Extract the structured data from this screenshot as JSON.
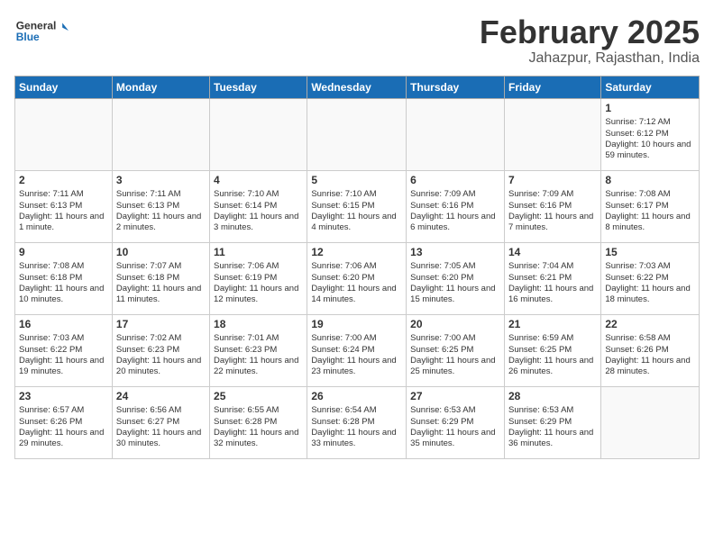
{
  "header": {
    "logo_text_general": "General",
    "logo_text_blue": "Blue",
    "month_title": "February 2025",
    "location": "Jahazpur, Rajasthan, India"
  },
  "calendar": {
    "days_of_week": [
      "Sunday",
      "Monday",
      "Tuesday",
      "Wednesday",
      "Thursday",
      "Friday",
      "Saturday"
    ],
    "weeks": [
      [
        {
          "day": "",
          "info": ""
        },
        {
          "day": "",
          "info": ""
        },
        {
          "day": "",
          "info": ""
        },
        {
          "day": "",
          "info": ""
        },
        {
          "day": "",
          "info": ""
        },
        {
          "day": "",
          "info": ""
        },
        {
          "day": "1",
          "info": "Sunrise: 7:12 AM\nSunset: 6:12 PM\nDaylight: 10 hours and 59 minutes."
        }
      ],
      [
        {
          "day": "2",
          "info": "Sunrise: 7:11 AM\nSunset: 6:13 PM\nDaylight: 11 hours and 1 minute."
        },
        {
          "day": "3",
          "info": "Sunrise: 7:11 AM\nSunset: 6:13 PM\nDaylight: 11 hours and 2 minutes."
        },
        {
          "day": "4",
          "info": "Sunrise: 7:10 AM\nSunset: 6:14 PM\nDaylight: 11 hours and 3 minutes."
        },
        {
          "day": "5",
          "info": "Sunrise: 7:10 AM\nSunset: 6:15 PM\nDaylight: 11 hours and 4 minutes."
        },
        {
          "day": "6",
          "info": "Sunrise: 7:09 AM\nSunset: 6:16 PM\nDaylight: 11 hours and 6 minutes."
        },
        {
          "day": "7",
          "info": "Sunrise: 7:09 AM\nSunset: 6:16 PM\nDaylight: 11 hours and 7 minutes."
        },
        {
          "day": "8",
          "info": "Sunrise: 7:08 AM\nSunset: 6:17 PM\nDaylight: 11 hours and 8 minutes."
        }
      ],
      [
        {
          "day": "9",
          "info": "Sunrise: 7:08 AM\nSunset: 6:18 PM\nDaylight: 11 hours and 10 minutes."
        },
        {
          "day": "10",
          "info": "Sunrise: 7:07 AM\nSunset: 6:18 PM\nDaylight: 11 hours and 11 minutes."
        },
        {
          "day": "11",
          "info": "Sunrise: 7:06 AM\nSunset: 6:19 PM\nDaylight: 11 hours and 12 minutes."
        },
        {
          "day": "12",
          "info": "Sunrise: 7:06 AM\nSunset: 6:20 PM\nDaylight: 11 hours and 14 minutes."
        },
        {
          "day": "13",
          "info": "Sunrise: 7:05 AM\nSunset: 6:20 PM\nDaylight: 11 hours and 15 minutes."
        },
        {
          "day": "14",
          "info": "Sunrise: 7:04 AM\nSunset: 6:21 PM\nDaylight: 11 hours and 16 minutes."
        },
        {
          "day": "15",
          "info": "Sunrise: 7:03 AM\nSunset: 6:22 PM\nDaylight: 11 hours and 18 minutes."
        }
      ],
      [
        {
          "day": "16",
          "info": "Sunrise: 7:03 AM\nSunset: 6:22 PM\nDaylight: 11 hours and 19 minutes."
        },
        {
          "day": "17",
          "info": "Sunrise: 7:02 AM\nSunset: 6:23 PM\nDaylight: 11 hours and 20 minutes."
        },
        {
          "day": "18",
          "info": "Sunrise: 7:01 AM\nSunset: 6:23 PM\nDaylight: 11 hours and 22 minutes."
        },
        {
          "day": "19",
          "info": "Sunrise: 7:00 AM\nSunset: 6:24 PM\nDaylight: 11 hours and 23 minutes."
        },
        {
          "day": "20",
          "info": "Sunrise: 7:00 AM\nSunset: 6:25 PM\nDaylight: 11 hours and 25 minutes."
        },
        {
          "day": "21",
          "info": "Sunrise: 6:59 AM\nSunset: 6:25 PM\nDaylight: 11 hours and 26 minutes."
        },
        {
          "day": "22",
          "info": "Sunrise: 6:58 AM\nSunset: 6:26 PM\nDaylight: 11 hours and 28 minutes."
        }
      ],
      [
        {
          "day": "23",
          "info": "Sunrise: 6:57 AM\nSunset: 6:26 PM\nDaylight: 11 hours and 29 minutes."
        },
        {
          "day": "24",
          "info": "Sunrise: 6:56 AM\nSunset: 6:27 PM\nDaylight: 11 hours and 30 minutes."
        },
        {
          "day": "25",
          "info": "Sunrise: 6:55 AM\nSunset: 6:28 PM\nDaylight: 11 hours and 32 minutes."
        },
        {
          "day": "26",
          "info": "Sunrise: 6:54 AM\nSunset: 6:28 PM\nDaylight: 11 hours and 33 minutes."
        },
        {
          "day": "27",
          "info": "Sunrise: 6:53 AM\nSunset: 6:29 PM\nDaylight: 11 hours and 35 minutes."
        },
        {
          "day": "28",
          "info": "Sunrise: 6:53 AM\nSunset: 6:29 PM\nDaylight: 11 hours and 36 minutes."
        },
        {
          "day": "",
          "info": ""
        }
      ]
    ]
  }
}
